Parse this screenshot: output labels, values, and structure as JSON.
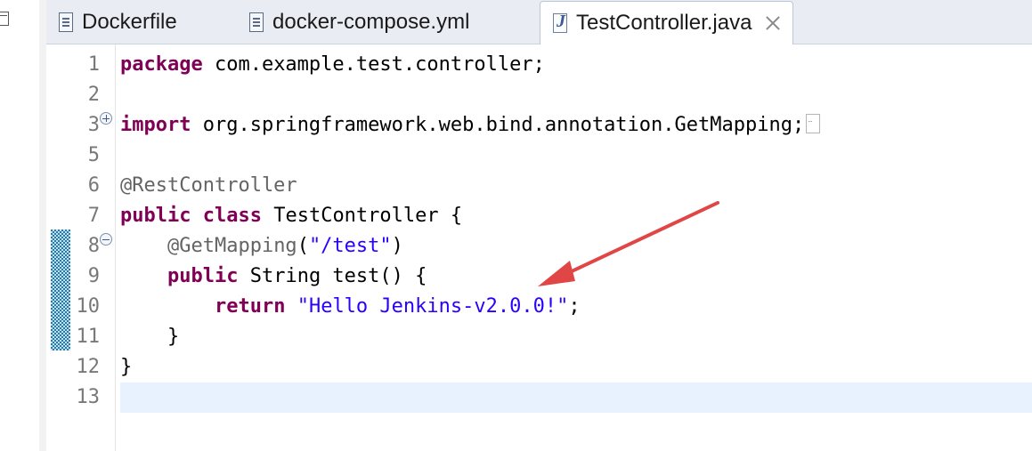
{
  "tabs": [
    {
      "label": "Dockerfile",
      "icon": "text-file-icon",
      "active": false
    },
    {
      "label": "docker-compose.yml",
      "icon": "text-file-icon",
      "active": false
    },
    {
      "label": "TestController.java",
      "icon": "java-file-icon",
      "active": true
    }
  ],
  "editor": {
    "current_line": 13,
    "lines": [
      {
        "n": "1",
        "tokens": [
          [
            "kw",
            "package"
          ],
          [
            "txt",
            " com.example.test.controller;"
          ]
        ]
      },
      {
        "n": "2",
        "tokens": []
      },
      {
        "n": "3",
        "fold": "expand",
        "folded_import": true,
        "tokens": [
          [
            "kw",
            "import"
          ],
          [
            "txt",
            " org.springframework.web.bind.annotation.GetMapping;"
          ]
        ]
      },
      {
        "n": "5",
        "tokens": []
      },
      {
        "n": "6",
        "tokens": [
          [
            "ann",
            "@RestController"
          ]
        ]
      },
      {
        "n": "7",
        "tokens": [
          [
            "kw",
            "public"
          ],
          [
            "txt",
            " "
          ],
          [
            "kw",
            "class"
          ],
          [
            "txt",
            " TestController {"
          ]
        ]
      },
      {
        "n": "8",
        "fold": "collapse",
        "tokens": [
          [
            "txt",
            "    "
          ],
          [
            "ann",
            "@GetMapping"
          ],
          [
            "txt",
            "("
          ],
          [
            "str",
            "\"/test\""
          ],
          [
            "txt",
            ")"
          ]
        ]
      },
      {
        "n": "9",
        "tokens": [
          [
            "txt",
            "    "
          ],
          [
            "kw",
            "public"
          ],
          [
            "txt",
            " String test() {"
          ]
        ]
      },
      {
        "n": "10",
        "tokens": [
          [
            "txt",
            "        "
          ],
          [
            "kw",
            "return"
          ],
          [
            "txt",
            " "
          ],
          [
            "str",
            "\"Hello Jenkins-v2.0.0!\""
          ],
          [
            "txt",
            ";"
          ]
        ]
      },
      {
        "n": "11",
        "tokens": [
          [
            "txt",
            "    }"
          ]
        ]
      },
      {
        "n": "12",
        "tokens": [
          [
            "txt",
            "}"
          ]
        ]
      },
      {
        "n": "13",
        "tokens": []
      }
    ]
  },
  "annotation": {
    "type": "arrow",
    "color": "#e04646"
  },
  "colors": {
    "keyword": "#7f0055",
    "annotation": "#646464",
    "string": "#2a00ff",
    "line_number": "#787878",
    "current_line_bg": "#e8f2fe",
    "change_marker": "#2a7aa8"
  }
}
